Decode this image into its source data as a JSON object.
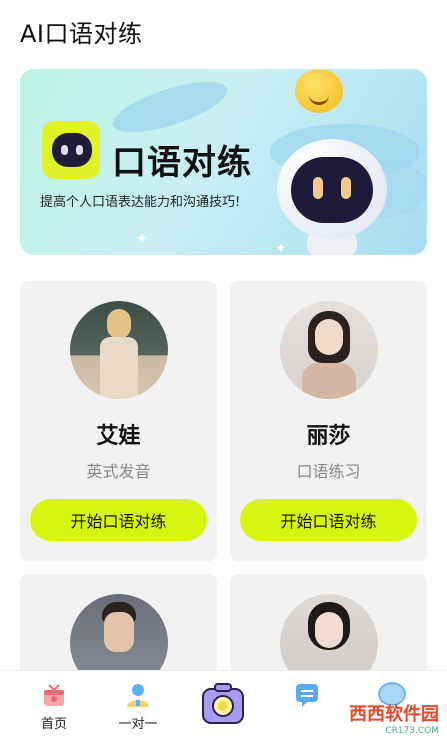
{
  "header": {
    "title": "AI口语对练"
  },
  "banner": {
    "title": "口语对练",
    "subtitle": "提高个人口语表达能力和沟通技巧!"
  },
  "cards": [
    {
      "name": "艾娃",
      "desc": "英式发音",
      "button": "开始口语对练"
    },
    {
      "name": "丽莎",
      "desc": "口语练习",
      "button": "开始口语对练"
    },
    {
      "name": "",
      "desc": "",
      "button": ""
    },
    {
      "name": "",
      "desc": "",
      "button": ""
    }
  ],
  "bottom_nav": {
    "items": [
      {
        "label": "首页",
        "icon": "home-icon"
      },
      {
        "label": "一对一",
        "icon": "user-icon"
      },
      {
        "label": "",
        "icon": "camera-icon"
      },
      {
        "label": "",
        "icon": "message-icon"
      },
      {
        "label": "",
        "icon": "profile-icon"
      }
    ]
  },
  "watermark": {
    "text": "西西软件园",
    "sub": "CR173.COM"
  },
  "colors": {
    "accent": "#d6f511",
    "card_bg": "#f2f2f3",
    "banner_bg": "#c9f0f3"
  }
}
